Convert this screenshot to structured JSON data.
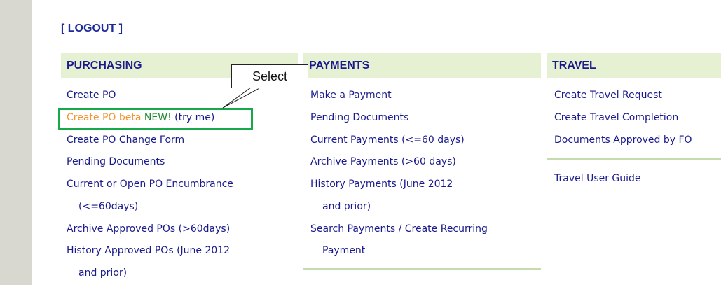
{
  "logout": "[ LOGOUT ]",
  "callout": {
    "label": "Select"
  },
  "purchasing": {
    "header": "PURCHASING",
    "items": [
      "Create PO",
      "Create PO Change Form",
      "Pending Documents",
      "Current or Open PO Encumbrance",
      "(<=60days)",
      "Archive Approved POs (>60days)",
      "History Approved POs (June 2012",
      "and prior)"
    ],
    "beta": {
      "label": "Create PO beta",
      "new": "NEW!",
      "tryme": "(try me)"
    }
  },
  "payments": {
    "header": "PAYMENTS",
    "items": [
      "Make a Payment",
      "Pending Documents",
      "Current Payments (<=60 days)",
      "Archive Payments  (>60 days)",
      "History Payments (June 2012",
      "and prior)",
      "Search Payments / Create Recurring",
      "Payment"
    ]
  },
  "travel": {
    "header": "TRAVEL",
    "items": [
      "Create Travel Request",
      "Create Travel Completion",
      "Documents Approved by FO",
      "Travel User Guide"
    ]
  },
  "colors": {
    "link": "#1a1a8c",
    "header_bg": "#e6f0d2",
    "beta": "#f29230",
    "new": "#1d8a2a",
    "highlight": "#17a84a"
  }
}
